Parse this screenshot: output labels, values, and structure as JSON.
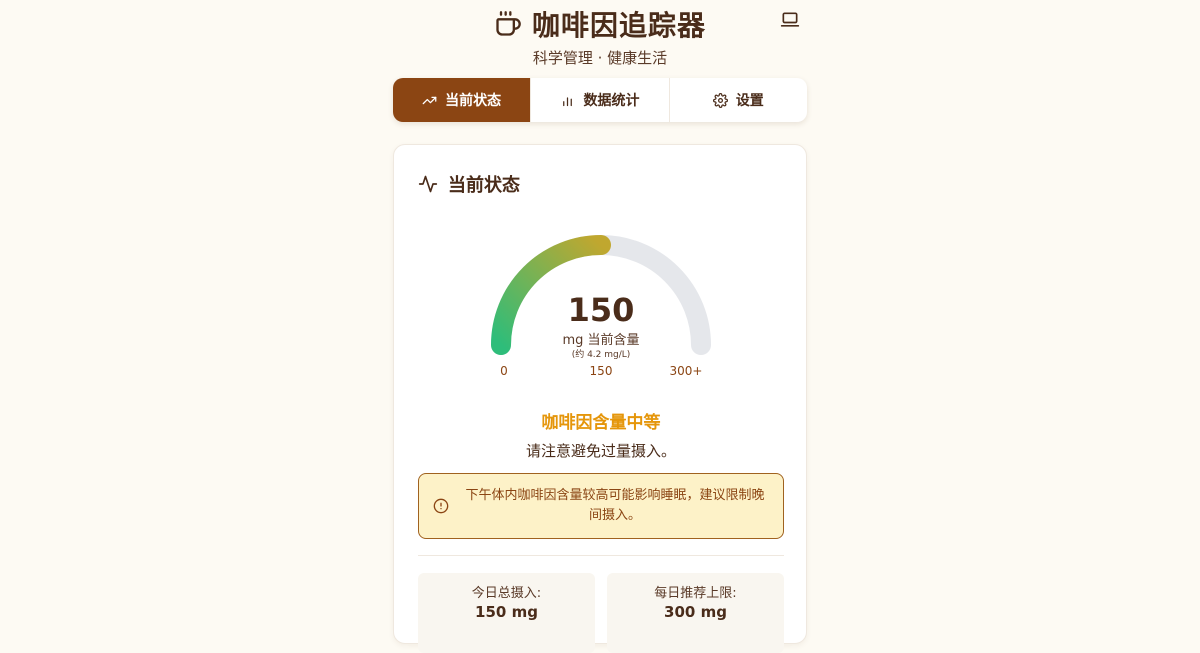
{
  "app": {
    "title": "咖啡因追踪器",
    "subtitle": "科学管理 · 健康生活",
    "title_icon": "coffee-cup-icon",
    "device_icon": "laptop-icon"
  },
  "tabs": [
    {
      "label": "当前状态",
      "icon": "trend-up-icon",
      "active": true
    },
    {
      "label": "数据统计",
      "icon": "bar-chart-icon",
      "active": false
    },
    {
      "label": "设置",
      "icon": "gear-icon",
      "active": false
    }
  ],
  "status_card": {
    "title": "当前状态",
    "title_icon": "activity-pulse-icon",
    "gauge": {
      "value": "150",
      "unit_label": "mg 当前含量",
      "concentration": "(约 4.2 mg/L)",
      "min_label": "0",
      "mid_label": "150",
      "max_label": "300+",
      "fill_fraction": 0.5,
      "gradient_colors": [
        "#2ebd7a",
        "#c0a72f"
      ],
      "track_color": "#e5e7eb"
    },
    "level_title": "咖啡因含量中等",
    "level_description": "请注意避免过量摄入。",
    "warning": {
      "text": "下午体内咖啡因含量较高可能影响睡眠，建议限制晚间摄入。",
      "icon": "alert-circle-icon"
    },
    "stats": [
      {
        "label": "今日总摄入:",
        "value": "150 mg"
      },
      {
        "label": "每日推荐上限:",
        "value": "300 mg"
      }
    ]
  },
  "colors": {
    "background": "#fdfaf3",
    "brand_brown": "#8b4513",
    "text_dark": "#4a2c1a",
    "level_moderate": "#e5960b",
    "warning_bg": "#fdf2c8"
  }
}
